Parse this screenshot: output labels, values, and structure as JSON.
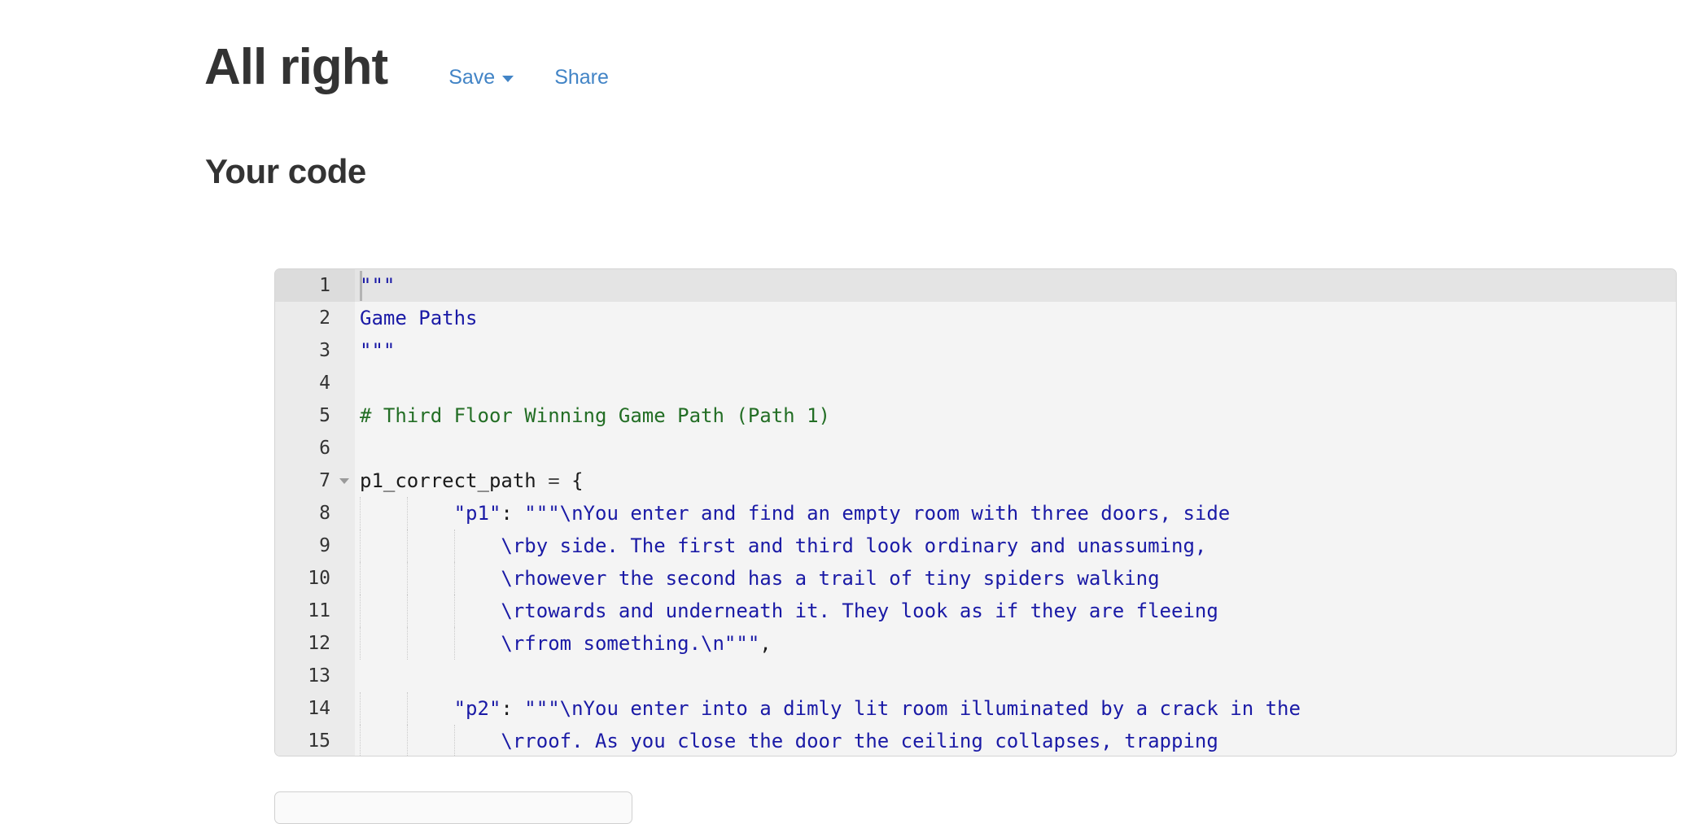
{
  "header": {
    "title": "All right",
    "actions": [
      {
        "label": "Save",
        "icon": "chevron-down-icon",
        "has_caret": true
      },
      {
        "label": "Share",
        "has_caret": false
      }
    ],
    "link_color": "#4284c6",
    "title_color": "#333333"
  },
  "section": {
    "title": "Your code"
  },
  "editor": {
    "language": "python",
    "active_line": 1,
    "cursor_line": 1,
    "cursor_column": 0,
    "fold_lines": [
      7
    ],
    "print_margin_column": 80,
    "colors": {
      "gutter_bg": "#ebebeb",
      "code_bg": "#f4f4f4",
      "active_gutter_bg": "#dcdcdc",
      "active_line_bg": "#e4e4e4",
      "string": "#1a1aa6",
      "comment": "#236e25",
      "identifier": "#1b1b1b",
      "print_margin": "#e0e0e0"
    },
    "lines": [
      {
        "num": "1",
        "indent_guides": 0,
        "tokens": [
          {
            "t": "\"\"\"",
            "c": "tok-str"
          }
        ]
      },
      {
        "num": "2",
        "indent_guides": 0,
        "tokens": [
          {
            "t": "Game Paths",
            "c": "tok-str"
          }
        ]
      },
      {
        "num": "3",
        "indent_guides": 0,
        "tokens": [
          {
            "t": "\"\"\"",
            "c": "tok-str"
          }
        ]
      },
      {
        "num": "4",
        "indent_guides": 0,
        "tokens": []
      },
      {
        "num": "5",
        "indent_guides": 0,
        "tokens": [
          {
            "t": "# Third Floor Winning Game Path (Path 1)",
            "c": "tok-cmt"
          }
        ]
      },
      {
        "num": "6",
        "indent_guides": 0,
        "tokens": []
      },
      {
        "num": "7",
        "indent_guides": 0,
        "fold": true,
        "tokens": [
          {
            "t": "p1_correct_path ",
            "c": "tok-id"
          },
          {
            "t": "= ",
            "c": "tok-op"
          },
          {
            "t": "{",
            "c": "tok-pun"
          }
        ]
      },
      {
        "num": "8",
        "indent_guides": 2,
        "tokens": [
          {
            "t": "        ",
            "c": "tok-id"
          },
          {
            "t": "\"p1\"",
            "c": "tok-str"
          },
          {
            "t": ": ",
            "c": "tok-pun"
          },
          {
            "t": "\"\"\"\\nYou enter and find an empty room with three doors, side",
            "c": "tok-str"
          }
        ]
      },
      {
        "num": "9",
        "indent_guides": 3,
        "tokens": [
          {
            "t": "            ",
            "c": "tok-id"
          },
          {
            "t": "\\rby side. The first and third look ordinary and unassuming,",
            "c": "tok-str"
          }
        ]
      },
      {
        "num": "10",
        "indent_guides": 3,
        "tokens": [
          {
            "t": "            ",
            "c": "tok-id"
          },
          {
            "t": "\\rhowever the second has a trail of tiny spiders walking",
            "c": "tok-str"
          }
        ]
      },
      {
        "num": "11",
        "indent_guides": 3,
        "tokens": [
          {
            "t": "            ",
            "c": "tok-id"
          },
          {
            "t": "\\rtowards and underneath it. They look as if they are fleeing",
            "c": "tok-str"
          }
        ]
      },
      {
        "num": "12",
        "indent_guides": 3,
        "tokens": [
          {
            "t": "            ",
            "c": "tok-id"
          },
          {
            "t": "\\rfrom something.\\n\"\"\"",
            "c": "tok-str"
          },
          {
            "t": ",",
            "c": "tok-pun"
          }
        ]
      },
      {
        "num": "13",
        "indent_guides": 0,
        "tokens": []
      },
      {
        "num": "14",
        "indent_guides": 2,
        "tokens": [
          {
            "t": "        ",
            "c": "tok-id"
          },
          {
            "t": "\"p2\"",
            "c": "tok-str"
          },
          {
            "t": ": ",
            "c": "tok-pun"
          },
          {
            "t": "\"\"\"\\nYou enter into a dimly lit room illuminated by a crack in the",
            "c": "tok-str"
          }
        ]
      },
      {
        "num": "15",
        "indent_guides": 3,
        "tokens": [
          {
            "t": "            ",
            "c": "tok-id"
          },
          {
            "t": "\\rroof. As you close the door the ceiling collapses, trapping",
            "c": "tok-str"
          }
        ]
      }
    ]
  }
}
